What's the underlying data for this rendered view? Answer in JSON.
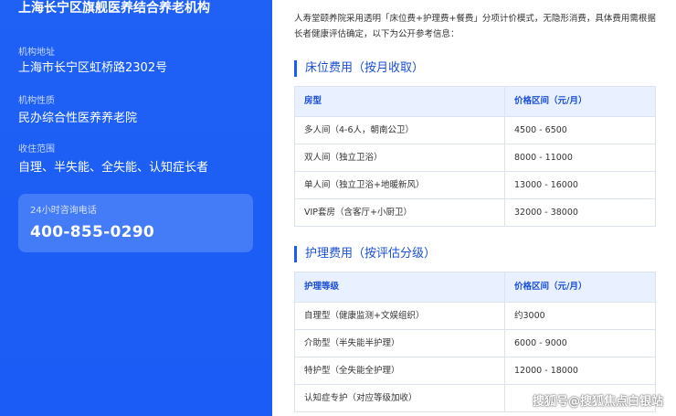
{
  "sidebar": {
    "org_name": "上海长宁区旗舰医养结合养老机构",
    "fields": [
      {
        "label": "机构地址",
        "value": "上海市长宁区虹桥路2302号"
      },
      {
        "label": "机构性质",
        "value": "民办综合性医养养老院"
      },
      {
        "label": "收住范围",
        "value": "自理、半失能、全失能、认知症长者"
      }
    ],
    "hotline": {
      "label": "24小时咨询电话",
      "number": "400-855-0290"
    }
  },
  "main": {
    "intro": "人寿堂颐养院采用透明「床位费+护理费+餐费」分项计价模式，无隐形消费，具体费用需根据长者健康评估确定，以下为公开参考信息：",
    "bed_section": {
      "title": "床位费用（按月收取）",
      "headers": [
        "房型",
        "价格区间（元/月）"
      ],
      "rows": [
        [
          "多人间（4-6人，朝南公卫）",
          "4500 - 6500"
        ],
        [
          "双人间（独立卫浴）",
          "8000 - 11000"
        ],
        [
          "单人间（独立卫浴+地暖新风）",
          "13000 - 16000"
        ],
        [
          "VIP套房（含客厅+小厨卫）",
          "32000 - 38000"
        ]
      ]
    },
    "care_section": {
      "title": "护理费用（按评估分级）",
      "headers": [
        "护理等级",
        "价格区间（元/月）"
      ],
      "rows": [
        [
          "自理型（健康监测+文娱组织）",
          "约3000"
        ],
        [
          "介助型（半失能半护理）",
          "6000 - 9000"
        ],
        [
          "特护型（全失能全护理）",
          "12000 - 18000"
        ],
        [
          "认知症专护（对应等级加收）",
          ""
        ]
      ]
    }
  },
  "watermark": "搜狐号@搜狐焦点白银站"
}
